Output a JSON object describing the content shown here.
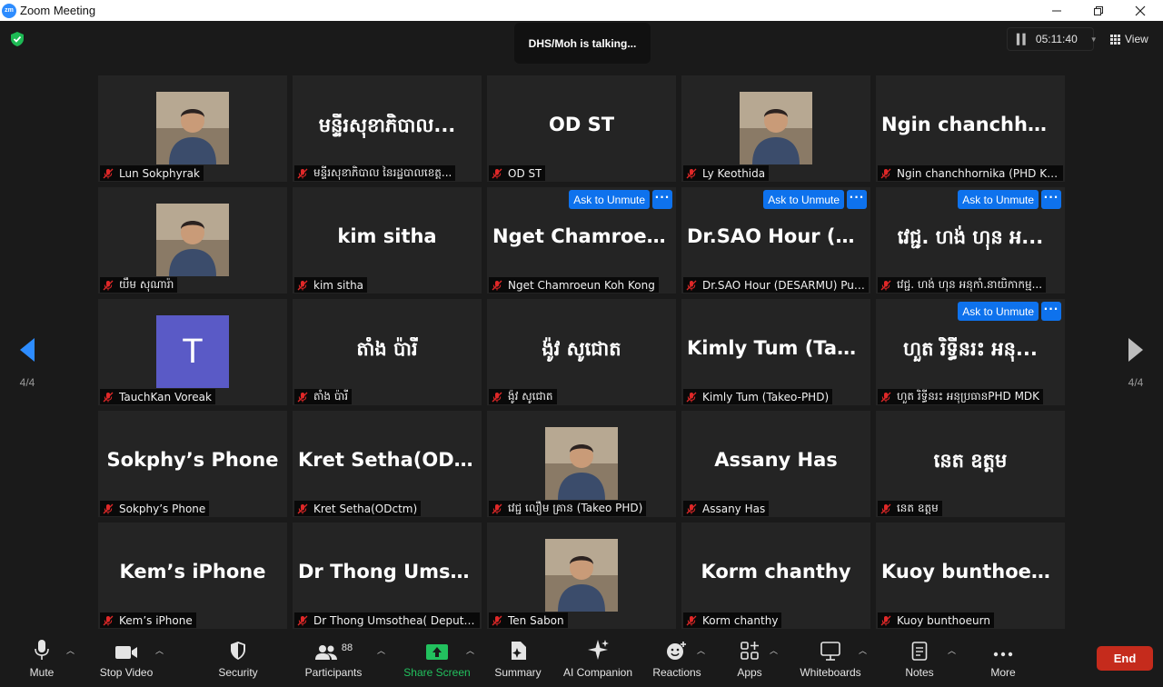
{
  "window": {
    "title": "Zoom Meeting",
    "logo_text": "zm"
  },
  "top": {
    "talking": "DHS/Moh is talking...",
    "timer": "05:11:40",
    "view_label": "View"
  },
  "pagination": {
    "left": "4/4",
    "right": "4/4"
  },
  "tiles": [
    {
      "center": "",
      "label": "Lun Sokphyrak",
      "photo": true
    },
    {
      "center": "មន្ទីរសុខាភិបាល...",
      "label": "មន្ទីរសុខាភិបាល នៃរដ្ឋបាលខេត្ត..."
    },
    {
      "center": "OD ST",
      "label": "OD ST"
    },
    {
      "center": "",
      "label": "Ly Keothida",
      "photo": true
    },
    {
      "center": "Ngin chanchhor...",
      "label": "Ngin chanchhornika (PHD KgC..."
    },
    {
      "center": "",
      "label": "យឹម សុណារ៉ា",
      "photo": true
    },
    {
      "center": "kim sitha",
      "label": "kim sitha"
    },
    {
      "center": "Nget Chamroeu...",
      "label": "Nget Chamroeun Koh Kong",
      "unmute": "Ask to Unmute"
    },
    {
      "center": "Dr.SAO Hour (D...",
      "label": "Dr.SAO Hour (DESARMU) Pursa...",
      "unmute": "Ask to Unmute"
    },
    {
      "center": "វេជ្ជ. ហង់ ហុន អ...",
      "label": "វេជ្ជ. ហង់ ហុន អនុកាំ.នាយិកាកម្ម...",
      "unmute": "Ask to Unmute"
    },
    {
      "center": "",
      "label": "TauchKan Voreak",
      "letter": "T"
    },
    {
      "center": "តាំង ប៉ារី",
      "label": "តាំង ប៉ារី"
    },
    {
      "center": "ង៉ូវ សូជោត",
      "label": "ង៉ូវ សូជោត"
    },
    {
      "center": "Kimly Tum (Tak...",
      "label": "Kimly Tum (Takeo-PHD)"
    },
    {
      "center": "ហួត រិទ្ធីនរះ អនុ...",
      "label": "ហួត រិទ្ធីនរះ អនុប្រធានPHD MDK",
      "unmute": "Ask to Unmute"
    },
    {
      "center": "Sokphy’s Phone",
      "label": "Sokphy’s Phone"
    },
    {
      "center": "Kret Setha(ODc...",
      "label": "Kret Setha(ODctm)"
    },
    {
      "center": "",
      "label": "វេជ្ជ លឿម គ្រាន (Takeo PHD)",
      "photo": true
    },
    {
      "center": "Assany Has",
      "label": "Assany Has"
    },
    {
      "center": "នេត ឧត្តម",
      "label": "នេត ឧត្តម"
    },
    {
      "center": "Kem’s iPhone",
      "label": "Kem’s iPhone"
    },
    {
      "center": "Dr Thong Umso...",
      "label": "Dr Thong Umsothea( Deputy di..."
    },
    {
      "center": "",
      "label": "Ten Sabon",
      "photo": true
    },
    {
      "center": "Korm chanthy",
      "label": "Korm  chanthy"
    },
    {
      "center": "Kuoy bunthoeurn",
      "label": "Kuoy bunthoeurn"
    }
  ],
  "more_dots": "···",
  "toolbar": {
    "mute": "Mute",
    "stop_video": "Stop Video",
    "security": "Security",
    "participants": "Participants",
    "participants_count": "88",
    "share_screen": "Share Screen",
    "summary": "Summary",
    "ai_companion": "AI Companion",
    "reactions": "Reactions",
    "apps": "Apps",
    "whiteboards": "Whiteboards",
    "notes": "Notes",
    "more": "More",
    "end": "End"
  },
  "colors": {
    "accent_blue": "#0e72ed",
    "share_green": "#22c15e",
    "end_red": "#c52b1c",
    "shield_green": "#1db954",
    "mic_off_red": "#e02828"
  }
}
